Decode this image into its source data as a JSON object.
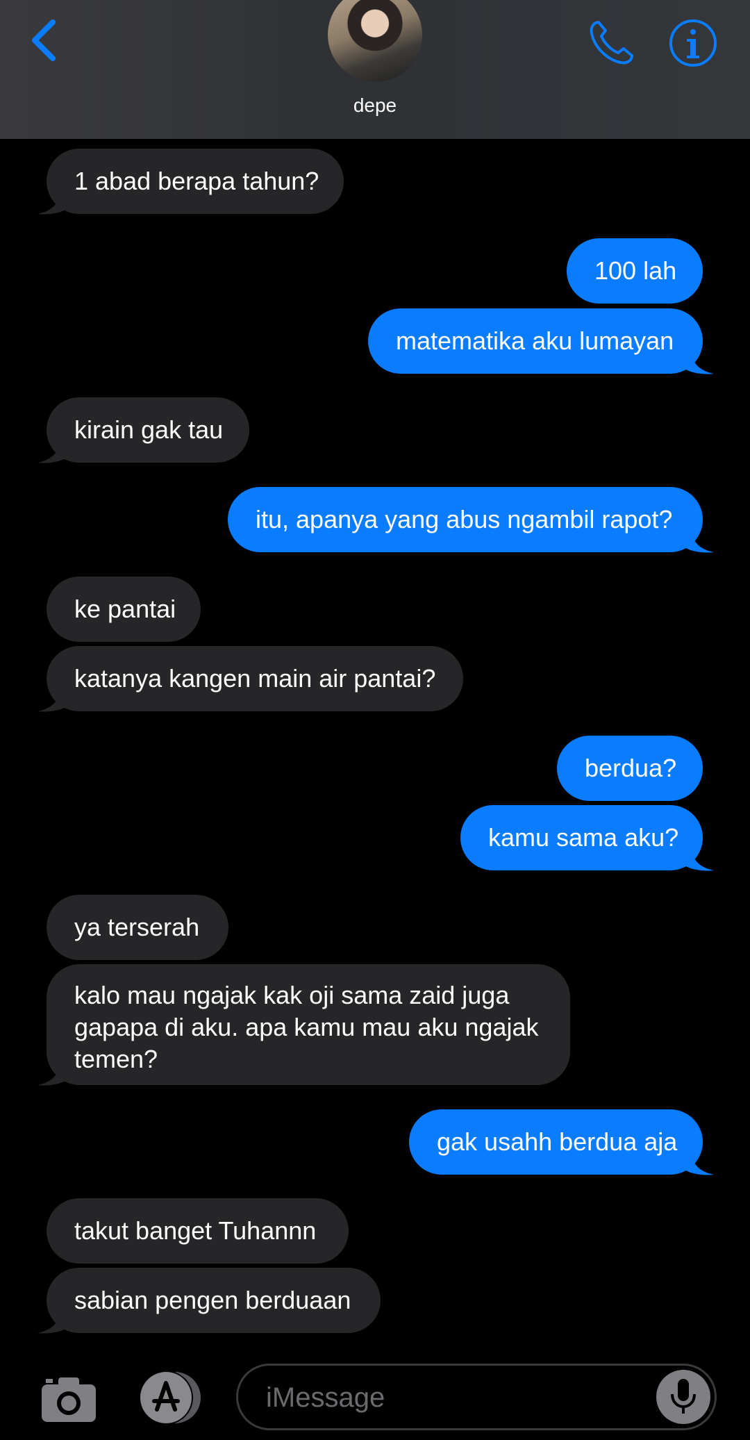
{
  "header": {
    "contact_name": "depe"
  },
  "messages": [
    {
      "side": "in",
      "text": "1 abad berapa tahun?"
    },
    {
      "side": "out",
      "text": "100 lah"
    },
    {
      "side": "out",
      "text": "matematika aku lumayan"
    },
    {
      "side": "in",
      "text": "kirain gak tau"
    },
    {
      "side": "out",
      "text": "itu, apanya yang abus ngambil rapot?"
    },
    {
      "side": "in",
      "text": "ke pantai"
    },
    {
      "side": "in",
      "text": "katanya kangen main air pantai?"
    },
    {
      "side": "out",
      "text": "berdua?"
    },
    {
      "side": "out",
      "text": "kamu sama aku?"
    },
    {
      "side": "in",
      "text": "ya terserah"
    },
    {
      "side": "in",
      "text": "kalo mau ngajak kak oji sama zaid juga gapapa di aku. apa kamu mau aku ngajak temen?"
    },
    {
      "side": "out",
      "text": "gak usahh berdua aja"
    },
    {
      "side": "in",
      "text": "takut banget Tuhannn"
    },
    {
      "side": "in",
      "text": "sabian pengen berduaan"
    }
  ],
  "composer": {
    "placeholder": "iMessage"
  },
  "colors": {
    "accent": "#0a7cff",
    "incoming_bubble": "#262628",
    "background": "#000000"
  }
}
